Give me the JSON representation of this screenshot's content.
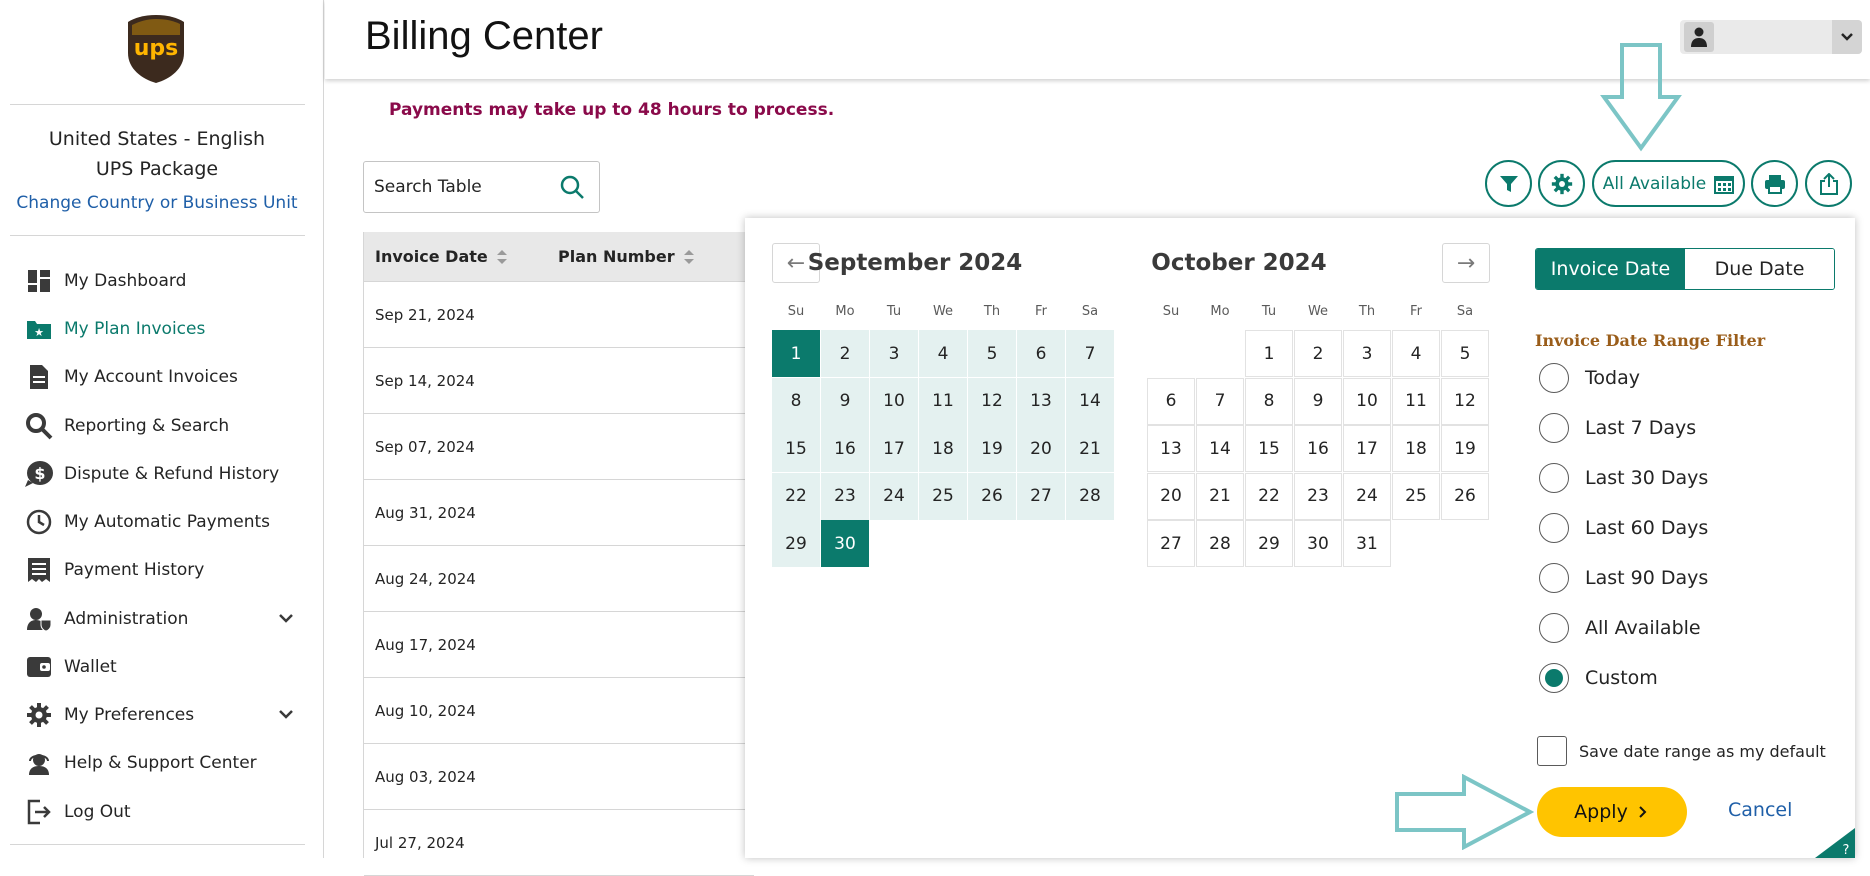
{
  "app": {
    "logo_text": "ups",
    "page_title": "Billing Center",
    "brand_color": "#0b7a6c",
    "accent_color": "#ffc400"
  },
  "sidebar": {
    "language": "United States - English",
    "unit": "UPS Package",
    "change_link": "Change Country or Business Unit",
    "items": [
      {
        "label": "My Dashboard",
        "icon": "dashboard-icon"
      },
      {
        "label": "My Plan Invoices",
        "icon": "folder-star-icon"
      },
      {
        "label": "My Account Invoices",
        "icon": "document-icon"
      },
      {
        "label": "Reporting & Search",
        "icon": "search-icon"
      },
      {
        "label": "Dispute & Refund History",
        "icon": "dollar-bubble-icon"
      },
      {
        "label": "My Automatic Payments",
        "icon": "clock-icon"
      },
      {
        "label": "Payment History",
        "icon": "receipt-icon"
      },
      {
        "label": "Administration",
        "icon": "shield-user-icon"
      },
      {
        "label": "Wallet",
        "icon": "wallet-icon"
      },
      {
        "label": "My Preferences",
        "icon": "gear-icon"
      },
      {
        "label": "Help & Support Center",
        "icon": "headset-icon"
      },
      {
        "label": "Log Out",
        "icon": "logout-icon"
      }
    ]
  },
  "main": {
    "notice": "Payments may take up to 48 hours to process.",
    "search_placeholder": "Search Table",
    "date_filter_label": "All Available",
    "table": {
      "columns": [
        "Invoice Date",
        "Plan Number"
      ],
      "rows": [
        "Sep 21, 2024",
        "Sep 14, 2024",
        "Sep 07, 2024",
        "Aug 31, 2024",
        "Aug 24, 2024",
        "Aug 17, 2024",
        "Aug 10, 2024",
        "Aug 03, 2024",
        "Jul 27, 2024"
      ]
    }
  },
  "datepicker": {
    "months": [
      "September 2024",
      "October 2024"
    ],
    "weekdays": [
      "Su",
      "Mo",
      "Tu",
      "We",
      "Th",
      "Fr",
      "Sa"
    ],
    "prev_arrow": "←",
    "next_arrow": "→",
    "tabs": {
      "invoice_date": "Invoice Date",
      "due_date": "Due Date"
    },
    "filter_title": "Invoice Date Range Filter",
    "options": [
      "Today",
      "Last 7 Days",
      "Last 30 Days",
      "Last 60 Days",
      "Last 90 Days",
      "All Available",
      "Custom"
    ],
    "selected_option": "Custom",
    "save_default_label": "Save date range as my default",
    "apply_label": "Apply",
    "cancel_label": "Cancel",
    "corner_label": "?"
  }
}
